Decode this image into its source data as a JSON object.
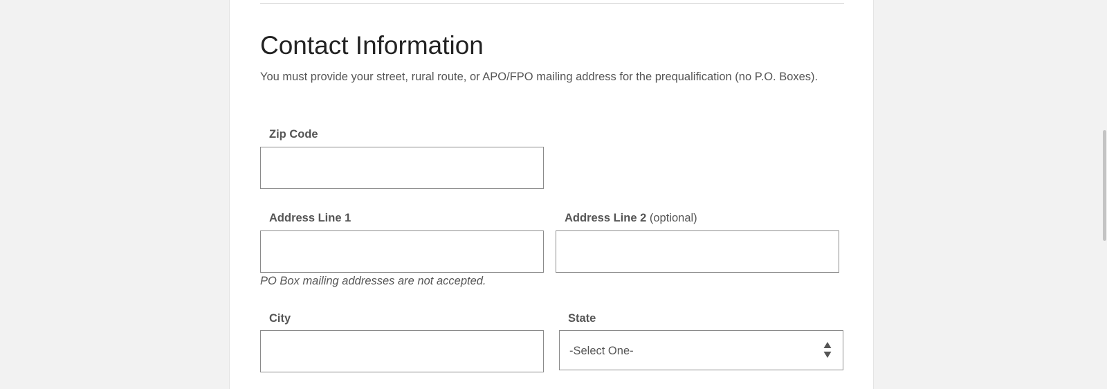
{
  "section": {
    "title": "Contact Information",
    "intro": "You must provide your street, rural route, or APO/FPO mailing address for the prequalification (no P.O. Boxes)."
  },
  "fields": {
    "zip": {
      "label": "Zip Code",
      "value": ""
    },
    "address1": {
      "label": "Address Line 1",
      "value": "",
      "hint": "PO Box mailing addresses are not accepted."
    },
    "address2": {
      "label": "Address Line 2",
      "optional": "(optional)",
      "value": ""
    },
    "city": {
      "label": "City",
      "value": ""
    },
    "state": {
      "label": "State",
      "selected": "-Select One-"
    }
  },
  "colors": {
    "page_bg": "#f2f2f2",
    "card_bg": "#ffffff",
    "text": "#555555",
    "heading": "#222222",
    "input_border": "#8a8a8a"
  }
}
